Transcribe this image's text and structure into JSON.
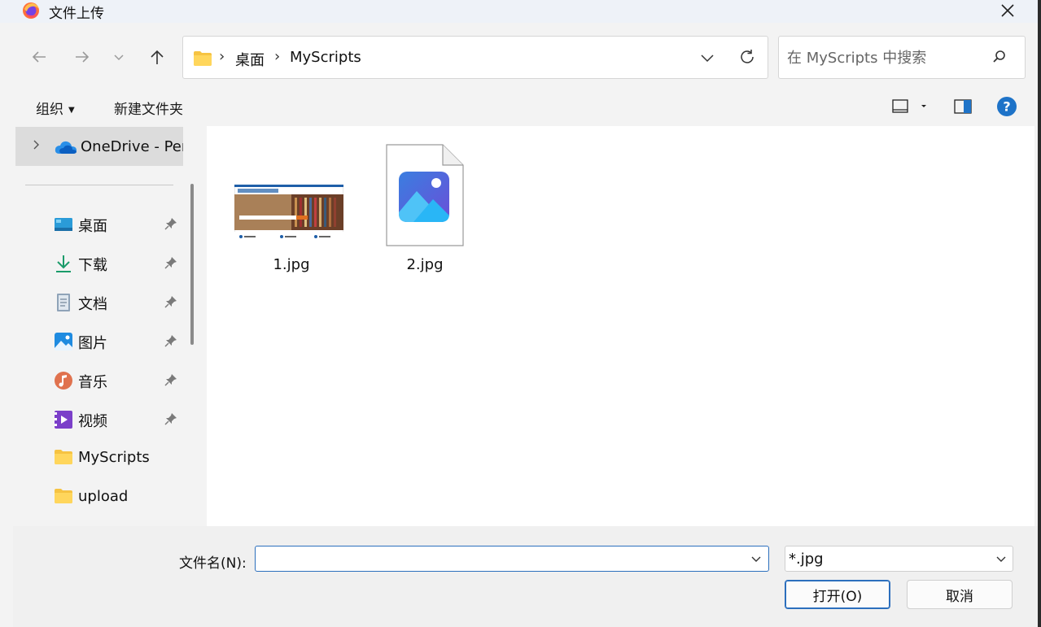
{
  "window": {
    "title": "文件上传",
    "app_icon": "firefox-icon",
    "close_icon": "close-icon"
  },
  "address": {
    "breadcrumbs": [
      "桌面",
      "MyScripts"
    ],
    "search_placeholder": "在 MyScripts 中搜索"
  },
  "toolbar": {
    "organize_label": "组织",
    "new_folder_label": "新建文件夹",
    "view_icon": "view-toggle-icon",
    "preview_icon": "preview-pane-icon",
    "help_icon": "help-icon"
  },
  "nav": {
    "onedrive_label": "OneDrive - Per",
    "items": [
      {
        "label": "桌面",
        "icon": "desktop-icon",
        "pinned": true
      },
      {
        "label": "下载",
        "icon": "download-icon",
        "pinned": true
      },
      {
        "label": "文档",
        "icon": "document-icon",
        "pinned": true
      },
      {
        "label": "图片",
        "icon": "pictures-icon",
        "pinned": true
      },
      {
        "label": "音乐",
        "icon": "music-icon",
        "pinned": true
      },
      {
        "label": "视频",
        "icon": "video-icon",
        "pinned": true
      },
      {
        "label": "MyScripts",
        "icon": "folder-icon",
        "pinned": false
      },
      {
        "label": "upload",
        "icon": "folder-icon",
        "pinned": false
      }
    ]
  },
  "files": [
    {
      "name": "1.jpg",
      "thumbnail": "library-website-thumbnail"
    },
    {
      "name": "2.jpg",
      "thumbnail": "image-file-icon"
    }
  ],
  "footer": {
    "filename_label": "文件名(N):",
    "filename_value": "",
    "filter_value": "*.jpg",
    "open_label": "打开(O)",
    "cancel_label": "取消"
  },
  "colors": {
    "accent": "#2c6fbd",
    "dialog_bg": "#f3f3f3",
    "selected_nav_bg": "#dcdcdc"
  }
}
